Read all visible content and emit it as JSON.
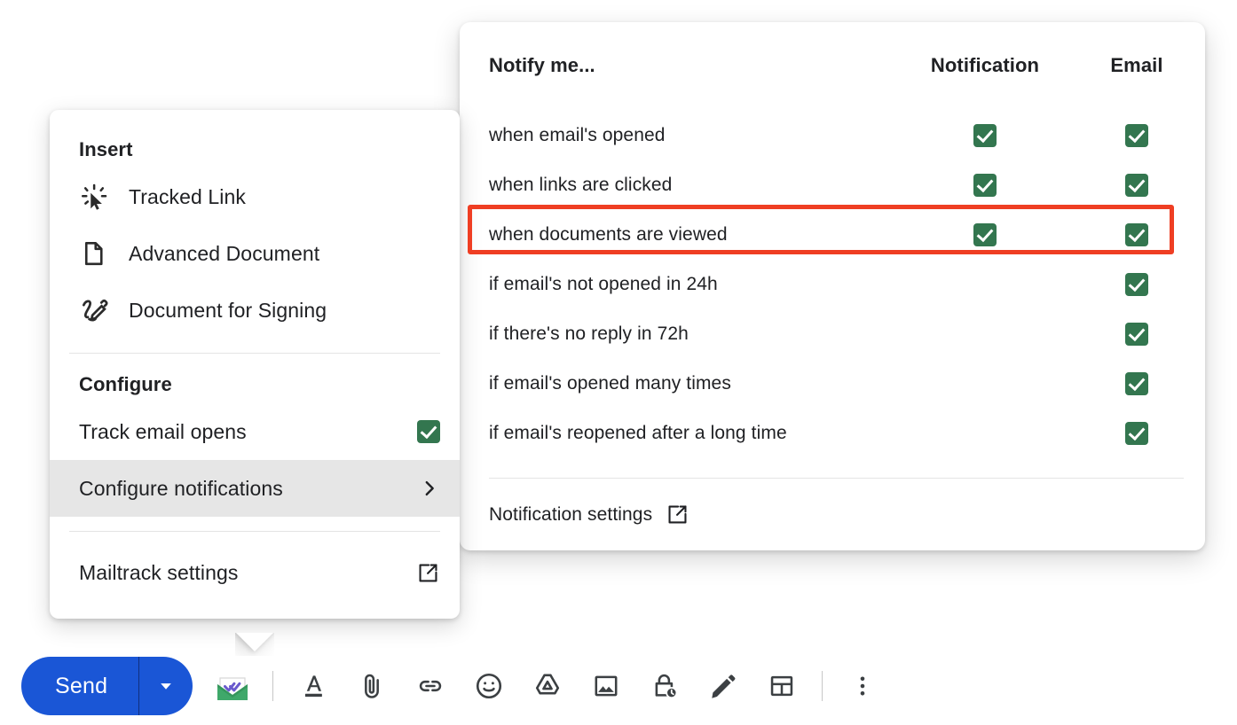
{
  "insert_menu": {
    "section_insert_title": "Insert",
    "insert_items": [
      {
        "label": "Tracked Link",
        "icon": "tracked-link-cursor-icon"
      },
      {
        "label": "Advanced Document",
        "icon": "document-page-icon"
      },
      {
        "label": "Document for Signing",
        "icon": "signature-pen-icon"
      }
    ],
    "section_configure_title": "Configure",
    "configure_items": [
      {
        "label": "Track email opens",
        "control": "checkbox",
        "checked": true,
        "selected": false
      },
      {
        "label": "Configure notifications",
        "control": "chevron-right",
        "selected": true
      }
    ],
    "footer_item": {
      "label": "Mailtrack settings",
      "icon": "external-link-icon"
    }
  },
  "notifications_panel": {
    "columns": {
      "label_header": "Notify me...",
      "notification_header": "Notification",
      "email_header": "Email"
    },
    "rows": [
      {
        "label": "when email's opened",
        "notification": true,
        "email": true,
        "notification_visible": true,
        "highlighted": false
      },
      {
        "label": "when links are clicked",
        "notification": true,
        "email": true,
        "notification_visible": true,
        "highlighted": false
      },
      {
        "label": "when documents are viewed",
        "notification": true,
        "email": true,
        "notification_visible": true,
        "highlighted": true
      },
      {
        "label": "if email's not opened in 24h",
        "notification": false,
        "email": true,
        "notification_visible": false,
        "highlighted": false
      },
      {
        "label": "if there's no reply in 72h",
        "notification": false,
        "email": true,
        "notification_visible": false,
        "highlighted": false
      },
      {
        "label": "if email's opened many times",
        "notification": false,
        "email": true,
        "notification_visible": false,
        "highlighted": false
      },
      {
        "label": "if email's reopened after a long time",
        "notification": false,
        "email": true,
        "notification_visible": false,
        "highlighted": false
      }
    ],
    "footer": {
      "label": "Notification settings",
      "icon": "external-link-icon"
    }
  },
  "toolbar": {
    "send_label": "Send",
    "send_dropdown_icon": "chevron-down-icon",
    "icons": [
      "mailtrack-envelope-icon",
      "format-text-icon",
      "attach-file-icon",
      "insert-link-icon",
      "insert-emoji-icon",
      "google-drive-icon",
      "insert-photo-icon",
      "confidential-mode-icon",
      "signature-pen-icon",
      "insert-template-icon",
      "more-options-icon"
    ]
  },
  "colors": {
    "accent_blue": "#1a56d6",
    "checkbox_green": "#33764f",
    "highlight_red": "#ef3e23",
    "mailtrack_green": "#3fa86a",
    "mailtrack_purple": "#6a5acd",
    "text": "#202124",
    "selected_row_bg": "#e6e6e6"
  }
}
